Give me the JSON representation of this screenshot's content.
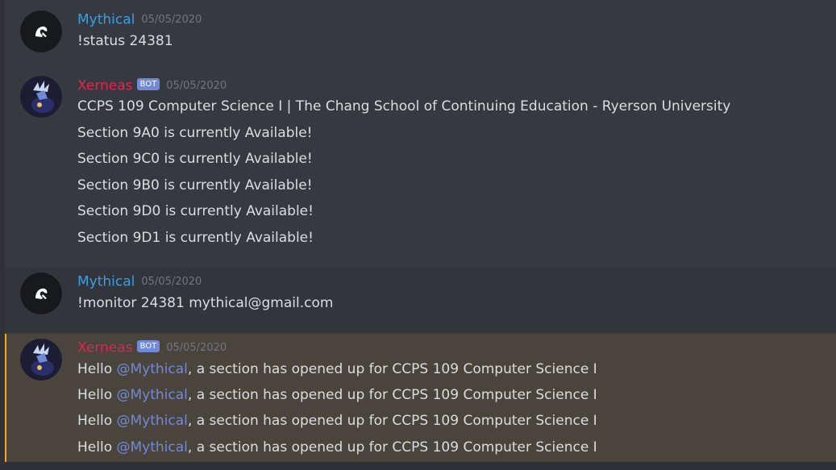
{
  "colors": {
    "background": "#36393f",
    "username_user": "#3d9de3",
    "username_bot": "#e0264e",
    "bot_tag": "#7289da",
    "mention_highlight": "#49443c",
    "mention_bar": "#faa61a",
    "text": "#dcddde",
    "timestamp": "#72767d"
  },
  "messages": [
    {
      "author": "Mythical",
      "avatar_icon": "mythical-avatar-icon",
      "timestamp": "05/05/2020",
      "lines": [
        "!status 24381"
      ]
    },
    {
      "author": "Xerneas",
      "bot_tag": "BOT",
      "avatar_icon": "xerneas-avatar-icon",
      "timestamp": "05/05/2020",
      "lines": [
        "CCPS 109 Computer Science I | The Chang School of Continuing Education - Ryerson University",
        "Section 9A0 is currently Available!",
        "Section 9C0 is currently Available!",
        "Section 9B0 is currently Available!",
        "Section 9D0 is currently Available!",
        "Section 9D1 is currently Available!"
      ]
    },
    {
      "author": "Mythical",
      "avatar_icon": "mythical-avatar-icon",
      "timestamp": "05/05/2020",
      "lines": [
        "!monitor 24381 mythical@gmail.com"
      ]
    },
    {
      "author": "Xerneas",
      "bot_tag": "BOT",
      "avatar_icon": "xerneas-avatar-icon",
      "timestamp": "05/05/2020",
      "mentions_you": true,
      "lines": [
        {
          "prefix": "Hello ",
          "mention": "@Mythical",
          "suffix": ", a section has opened up for CCPS 109 Computer Science I"
        },
        {
          "prefix": "Hello ",
          "mention": "@Mythical",
          "suffix": ", a section has opened up for CCPS 109 Computer Science I"
        },
        {
          "prefix": "Hello ",
          "mention": "@Mythical",
          "suffix": ", a section has opened up for CCPS 109 Computer Science I"
        },
        {
          "prefix": "Hello ",
          "mention": "@Mythical",
          "suffix": ", a section has opened up for CCPS 109 Computer Science I"
        }
      ]
    }
  ]
}
